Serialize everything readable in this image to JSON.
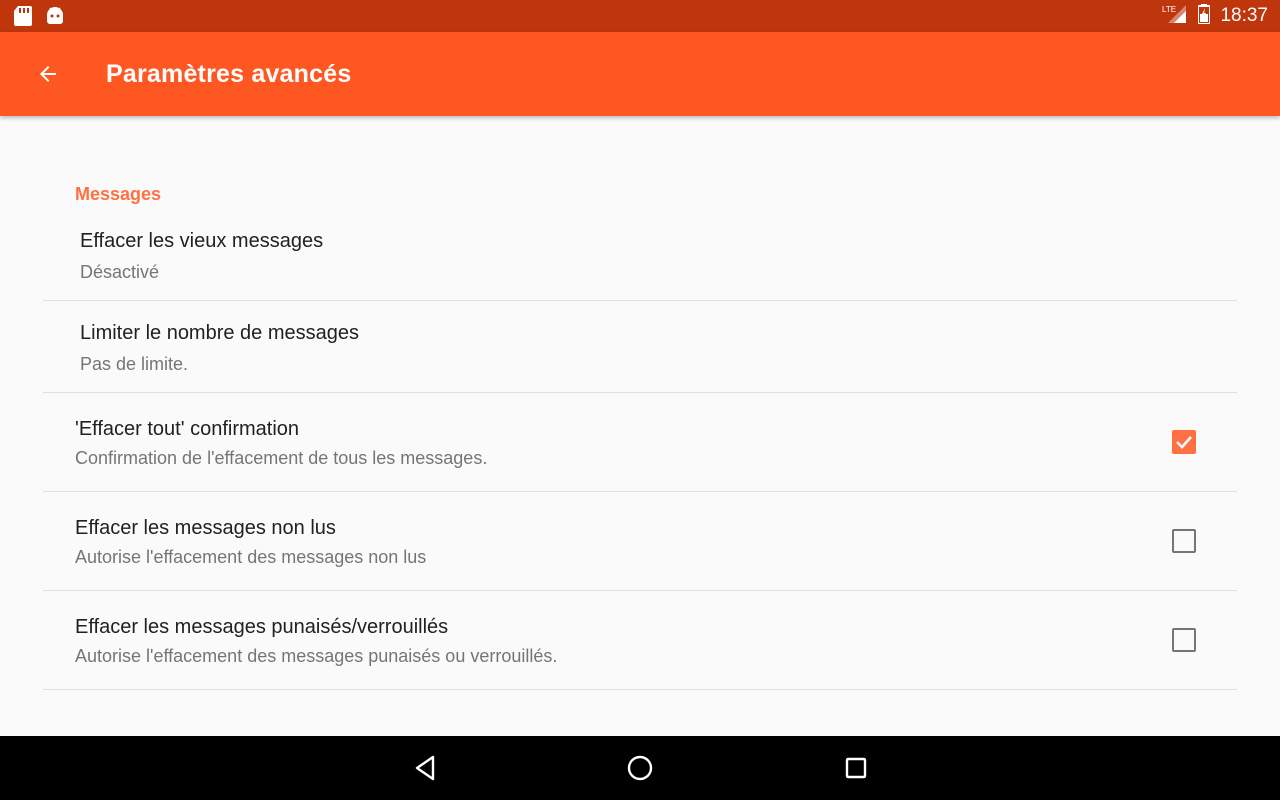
{
  "status_bar": {
    "icons_left": [
      "sd-card-icon",
      "android-icon"
    ],
    "network": "LTE",
    "time": "18:37"
  },
  "app_bar": {
    "title": "Paramètres avancés",
    "back_icon": "arrow-back-icon",
    "color": "#ff5722"
  },
  "section": {
    "header": "Messages",
    "accent": "#ff7043"
  },
  "prefs": [
    {
      "title": "Effacer les vieux messages",
      "summary": "Désactivé"
    },
    {
      "title": "Limiter le nombre de messages",
      "summary": "Pas de limite."
    },
    {
      "title": "'Effacer tout' confirmation",
      "summary": "Confirmation de l'effacement de tous les messages.",
      "checked": true
    },
    {
      "title": "Effacer les messages non lus",
      "summary": "Autorise l'effacement des messages non lus",
      "checked": false
    },
    {
      "title": "Effacer les messages punaisés/verrouillés",
      "summary": "Autorise l'effacement des messages punaisés ou verrouillés.",
      "checked": false
    }
  ],
  "nav_bar": [
    "back-nav-icon",
    "home-nav-icon",
    "recents-nav-icon"
  ]
}
